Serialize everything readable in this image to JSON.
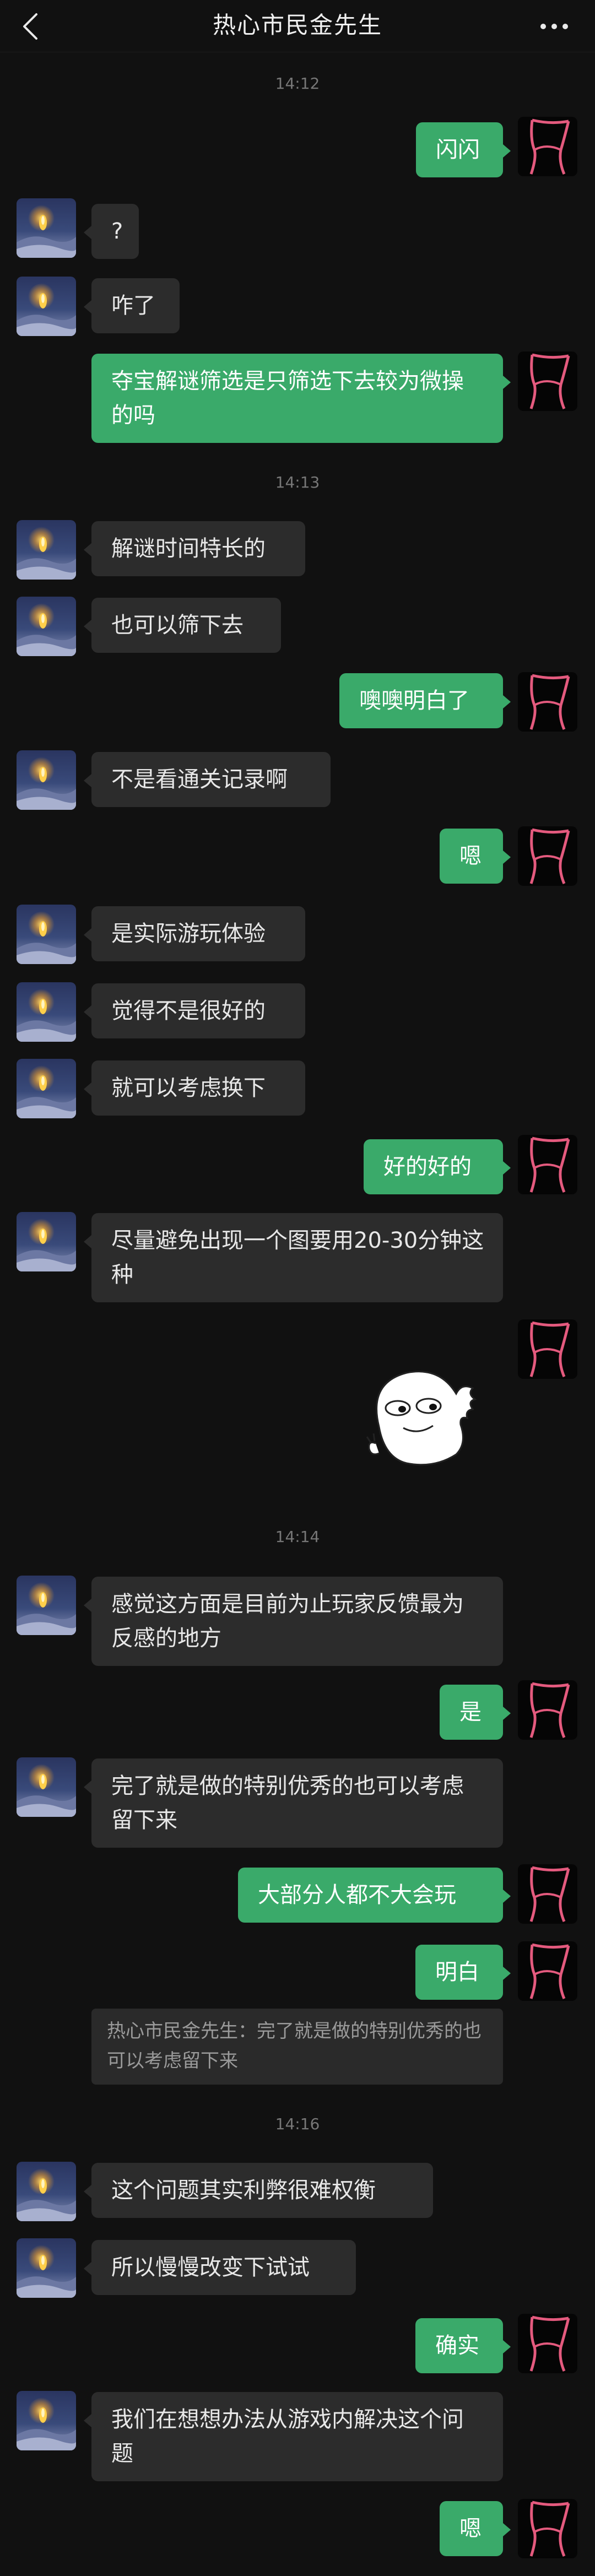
{
  "header": {
    "title": "热心市民金先生"
  },
  "timestamps": [
    "14:12",
    "14:13",
    "14:14",
    "14:16"
  ],
  "messages": [
    {
      "side": "out",
      "text": "闪闪"
    },
    {
      "side": "in",
      "text": "?"
    },
    {
      "side": "in",
      "text": "咋了"
    },
    {
      "side": "out",
      "text": "夺宝解谜筛选是只筛选下去较为微操的吗"
    },
    {
      "side": "in",
      "text": "解谜时间特长的"
    },
    {
      "side": "in",
      "text": "也可以筛下去"
    },
    {
      "side": "out",
      "text": "噢噢明白了"
    },
    {
      "side": "in",
      "text": "不是看通关记录啊"
    },
    {
      "side": "out",
      "text": "嗯"
    },
    {
      "side": "in",
      "text": "是实际游玩体验"
    },
    {
      "side": "in",
      "text": "觉得不是很好的"
    },
    {
      "side": "in",
      "text": "就可以考虑换下"
    },
    {
      "side": "out",
      "text": "好的好的"
    },
    {
      "side": "in",
      "text": "尽量避免出现一个图要用20-30分钟这种"
    },
    {
      "side": "in",
      "text": "感觉这方面是目前为止玩家反馈最为反感的地方"
    },
    {
      "side": "out",
      "text": "是"
    },
    {
      "side": "in",
      "text": "完了就是做的特别优秀的也可以考虑留下来"
    },
    {
      "side": "out",
      "text": "大部分人都不大会玩"
    },
    {
      "side": "out",
      "text": "明白"
    },
    {
      "side": "in",
      "text": "这个问题其实利弊很难权衡"
    },
    {
      "side": "in",
      "text": "所以慢慢改变下试试"
    },
    {
      "side": "out",
      "text": "确实"
    },
    {
      "side": "in",
      "text": "我们在想想办法从游戏内解决这个问题"
    },
    {
      "side": "out",
      "text": "嗯"
    }
  ],
  "quote": {
    "text": "热心市民金先生：完了就是做的特别优秀的也可以考虑留下来"
  },
  "icons": {
    "back": "back-arrow-icon",
    "more": "more-dots-icon",
    "sticker": "dinosaur-sticker"
  },
  "colors": {
    "background": "#111111",
    "incoming_bubble": "#2c2c2c",
    "outgoing_bubble": "#3aaa6a"
  }
}
